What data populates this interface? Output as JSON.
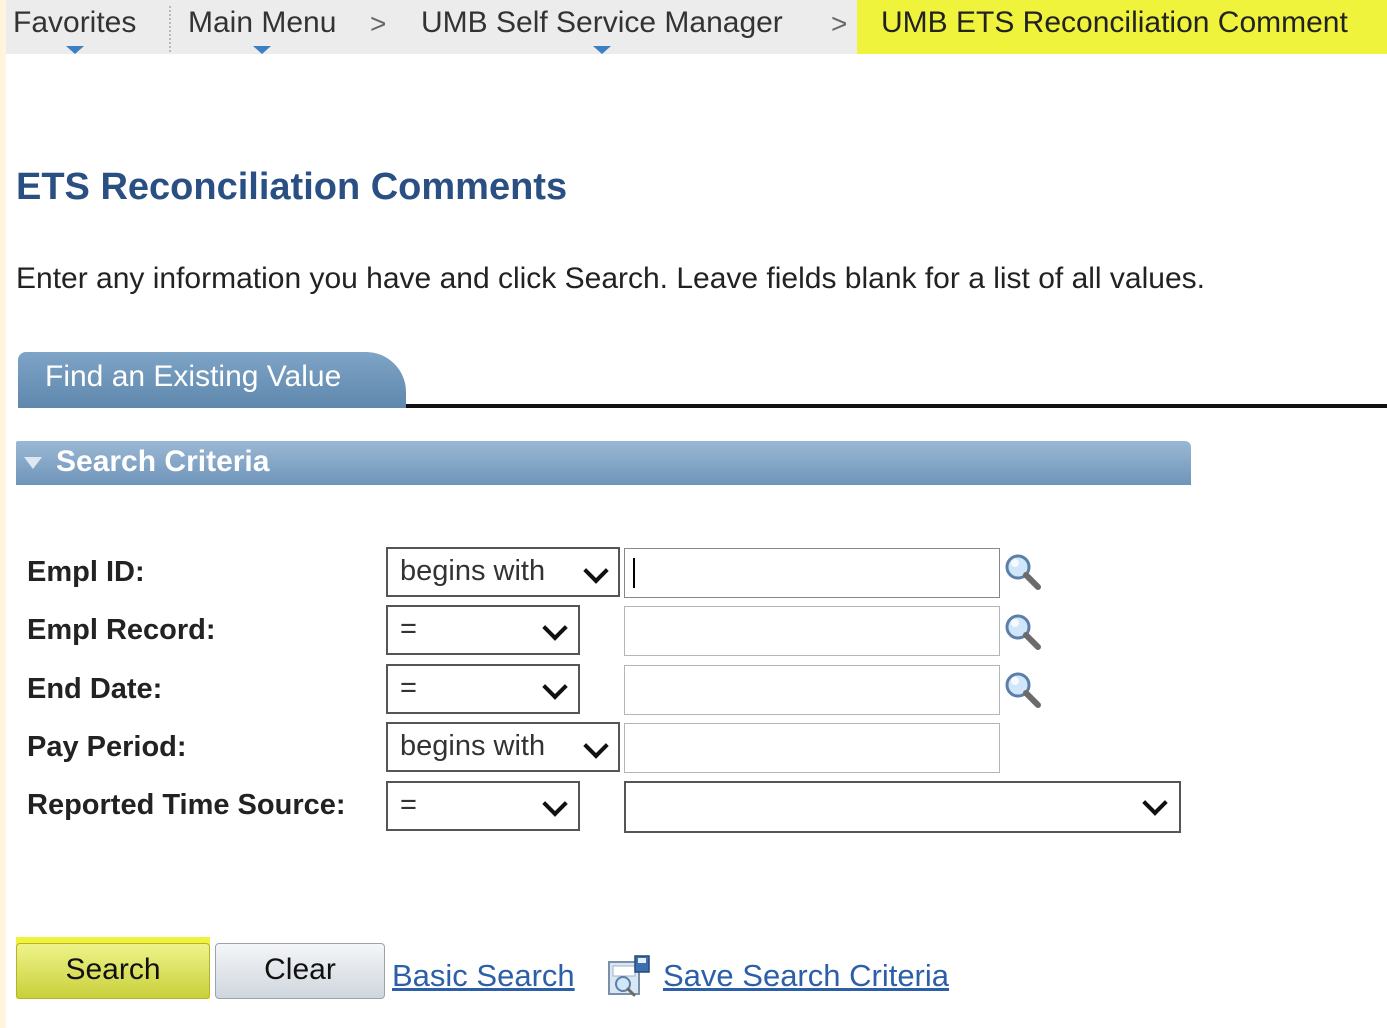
{
  "nav": {
    "favorites": "Favorites",
    "main_menu": "Main Menu",
    "self_service": "UMB Self Service Manager",
    "current": "UMB ETS Reconciliation Comment",
    "separator": ">"
  },
  "page": {
    "title": "ETS Reconciliation Comments",
    "instructions": "Enter any information you have and click Search. Leave fields blank for a list of all values."
  },
  "tab": {
    "label": "Find an Existing Value"
  },
  "section": {
    "title": "Search Criteria"
  },
  "fields": [
    {
      "label": "Empl ID:",
      "operator": "begins with",
      "value": ""
    },
    {
      "label": "Empl Record:",
      "operator": "=",
      "value": ""
    },
    {
      "label": "End Date:",
      "operator": "=",
      "value": ""
    },
    {
      "label": "Pay Period:",
      "operator": "begins with",
      "value": ""
    },
    {
      "label": "Reported Time Source:",
      "operator": "=",
      "value": ""
    }
  ],
  "buttons": {
    "search": "Search",
    "clear": "Clear",
    "basic_search": "Basic Search",
    "save_search_criteria": "Save Search Criteria"
  },
  "colors": {
    "title": "#2a4f83",
    "highlight": "#f0f33c",
    "link": "#2c5fa8",
    "header_blue": "#6f95ba"
  },
  "icons": [
    "lookup-magnifier-icon",
    "save-search-icon",
    "collapse-triangle-icon",
    "dropdown-chevron-icon"
  ]
}
